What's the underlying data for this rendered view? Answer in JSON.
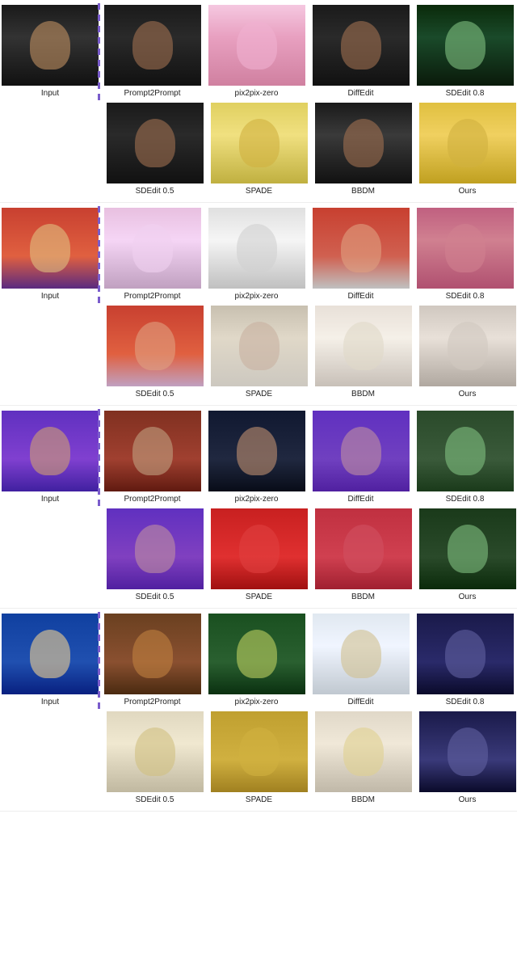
{
  "sections": [
    {
      "id": "section1",
      "label": "Input",
      "top_labels": [
        "Prompt2Prompt",
        "pix2pix-zero",
        "DiffEdit",
        "SDEdit 0.8"
      ],
      "bottom_labels": [
        "SDEdit 0.5",
        "SPADE",
        "BBDM",
        "Ours"
      ],
      "top_colors": [
        "s1-p2p",
        "s1-pix",
        "s1-diff",
        "s1-sde08"
      ],
      "bottom_colors": [
        "s1-sde05",
        "s1-spade",
        "s1-bbdm",
        "s1-ours"
      ],
      "input_color": "s1-input"
    },
    {
      "id": "section2",
      "label": "Input",
      "top_labels": [
        "Prompt2Prompt",
        "pix2pix-zero",
        "DiffEdit",
        "SDEdit 0.8"
      ],
      "bottom_labels": [
        "SDEdit 0.5",
        "SPADE",
        "BBDM",
        "Ours"
      ],
      "top_colors": [
        "s2-p2p",
        "s2-pix",
        "s2-diff",
        "s2-sde08"
      ],
      "bottom_colors": [
        "s2-sde05",
        "s2-spade",
        "s2-bbdm",
        "s2-ours"
      ],
      "input_color": "s2-input"
    },
    {
      "id": "section3",
      "label": "Input",
      "top_labels": [
        "Prompt2Prompt",
        "pix2pix-zero",
        "DiffEdit",
        "SDEdit 0.8"
      ],
      "bottom_labels": [
        "SDEdit 0.5",
        "SPADE",
        "BBDM",
        "Ours"
      ],
      "top_colors": [
        "s3-p2p",
        "s3-pix",
        "s3-diff",
        "s3-sde08"
      ],
      "bottom_colors": [
        "s3-sde05",
        "s3-spade",
        "s3-bbdm",
        "s3-ours"
      ],
      "input_color": "s3-input"
    },
    {
      "id": "section4",
      "label": "Input",
      "top_labels": [
        "Prompt2Prompt",
        "pix2pix-zero",
        "DiffEdit",
        "SDEdit 0.8"
      ],
      "bottom_labels": [
        "SDEdit 0.5",
        "SPADE",
        "BBDM",
        "Ours"
      ],
      "top_colors": [
        "s4-p2p",
        "s4-pix",
        "s4-diff",
        "s4-sde08"
      ],
      "bottom_colors": [
        "s4-sde05",
        "s4-spade",
        "s4-bbdm",
        "s4-ours"
      ],
      "input_color": "s4-input"
    }
  ]
}
